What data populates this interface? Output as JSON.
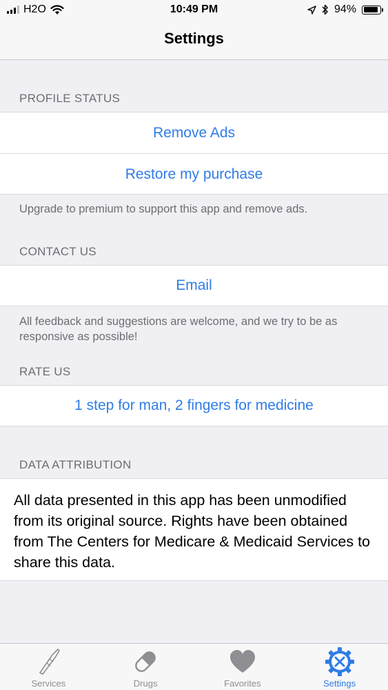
{
  "status_bar": {
    "carrier": "H2O",
    "time": "10:49 PM",
    "battery": "94%",
    "battery_level": 0.94,
    "icons": [
      "signal-icon",
      "wifi-icon",
      "location-icon",
      "bluetooth-icon",
      "battery-icon"
    ]
  },
  "nav": {
    "title": "Settings"
  },
  "profile": {
    "header": "PROFILE STATUS",
    "remove_ads": "Remove Ads",
    "restore": "Restore my purchase",
    "footer": "Upgrade to premium to support this app and remove ads."
  },
  "contact": {
    "header": "CONTACT US",
    "email": "Email",
    "footer": "All feedback and suggestions are welcome, and we try to be as responsive as possible!"
  },
  "rate": {
    "header": "RATE US",
    "button": "1 step for man, 2 fingers for medicine"
  },
  "attribution": {
    "header": "DATA ATTRIBUTION",
    "text": "All data presented in this app has been unmodified from its original source. Rights have been obtained from The Centers for Medicare & Medicaid Services to share this data."
  },
  "tabs": [
    {
      "label": "Services",
      "icon": "scalpel-icon",
      "active": false
    },
    {
      "label": "Drugs",
      "icon": "pill-icon",
      "active": false
    },
    {
      "label": "Favorites",
      "icon": "heart-icon",
      "active": false
    },
    {
      "label": "Settings",
      "icon": "settings-icon",
      "active": true
    }
  ],
  "colors": {
    "accent": "#2f7ce6",
    "inactive": "#8e8e93",
    "background": "#efeff4"
  }
}
